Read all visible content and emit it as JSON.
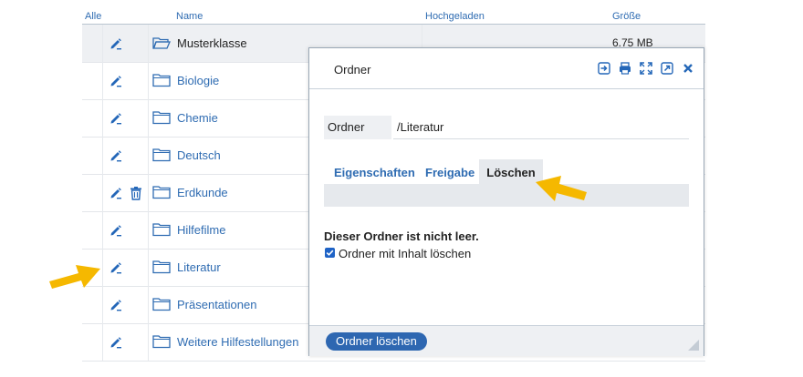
{
  "table": {
    "headers": {
      "all": "Alle",
      "name": "Name",
      "uploaded": "Hochgeladen",
      "size": "Größe"
    },
    "rows": [
      {
        "name": "Musterklasse",
        "size": "6.75 MB"
      },
      {
        "name": "Biologie",
        "size": ""
      },
      {
        "name": "Chemie",
        "size": ""
      },
      {
        "name": "Deutsch",
        "size": ""
      },
      {
        "name": "Erdkunde",
        "size": ""
      },
      {
        "name": "Hilfefilme",
        "size": ""
      },
      {
        "name": "Literatur",
        "size": ""
      },
      {
        "name": "Präsentationen",
        "size": ""
      },
      {
        "name": "Weitere Hilfestellungen",
        "size": ""
      }
    ]
  },
  "dialog": {
    "title": "Ordner",
    "field_label": "Ordner",
    "field_value": "/Literatur",
    "tabs": [
      "Eigenschaften",
      "Freigabe",
      "Löschen"
    ],
    "active_tab": "Löschen",
    "warning": "Dieser Ordner ist nicht leer.",
    "checkbox_label": "Ordner mit Inhalt löschen",
    "checkbox_checked": true,
    "delete_button": "Ordner löschen"
  },
  "colors": {
    "link": "#2f6cb2",
    "accent": "#2e67b1",
    "highlight_arrow": "#f5b800"
  }
}
